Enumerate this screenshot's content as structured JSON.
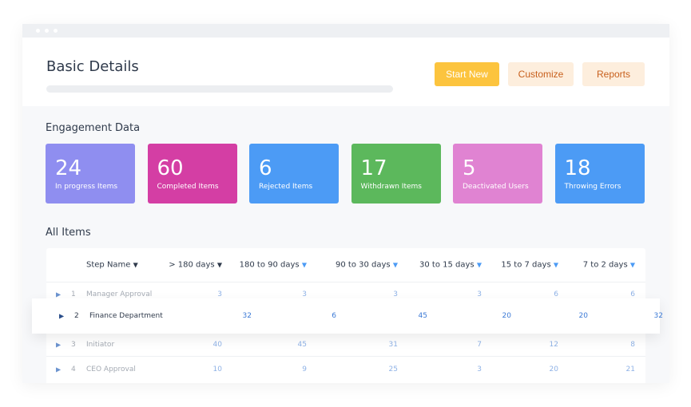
{
  "header": {
    "title": "Basic Details",
    "buttons": [
      {
        "label": "Start New",
        "bg": "#fcc43e",
        "color": "#ffffff"
      },
      {
        "label": "Customize",
        "bg": "#fdeedd",
        "color": "#c8601d"
      },
      {
        "label": "Reports",
        "bg": "#fdeedd",
        "color": "#c8601d"
      }
    ]
  },
  "engagement": {
    "title": "Engagement Data",
    "cards": [
      {
        "value": "24",
        "label": "In progress Items",
        "color": "#8f8ef0"
      },
      {
        "value": "60",
        "label": "Completed Items",
        "color": "#d43ea4"
      },
      {
        "value": "6",
        "label": "Rejected Items",
        "color": "#4c9bf5"
      },
      {
        "value": "17",
        "label": "Withdrawn Items",
        "color": "#5cb85c"
      },
      {
        "value": "5",
        "label": "Deactivated Users",
        "color": "#e083d2"
      },
      {
        "value": "18",
        "label": "Throwing Errors",
        "color": "#4c9bf5"
      }
    ]
  },
  "table": {
    "title": "All Items",
    "columns": [
      "Step Name",
      "> 180 days",
      "180 to 90 days",
      "90 to 30 days",
      "30 to 15 days",
      "15 to 7 days",
      "7 to 2 days"
    ],
    "rows": [
      {
        "idx": "1",
        "name": "Manager Approval",
        "values": [
          "3",
          "3",
          "3",
          "3",
          "6",
          "6"
        ]
      },
      {
        "idx": "2",
        "name": "Finance Department",
        "values": [
          "32",
          "6",
          "45",
          "20",
          "20",
          "32"
        ]
      },
      {
        "idx": "3",
        "name": "Initiator",
        "values": [
          "40",
          "45",
          "31",
          "7",
          "12",
          "8"
        ]
      },
      {
        "idx": "4",
        "name": "CEO Approval",
        "values": [
          "10",
          "9",
          "25",
          "3",
          "20",
          "21"
        ]
      }
    ]
  }
}
